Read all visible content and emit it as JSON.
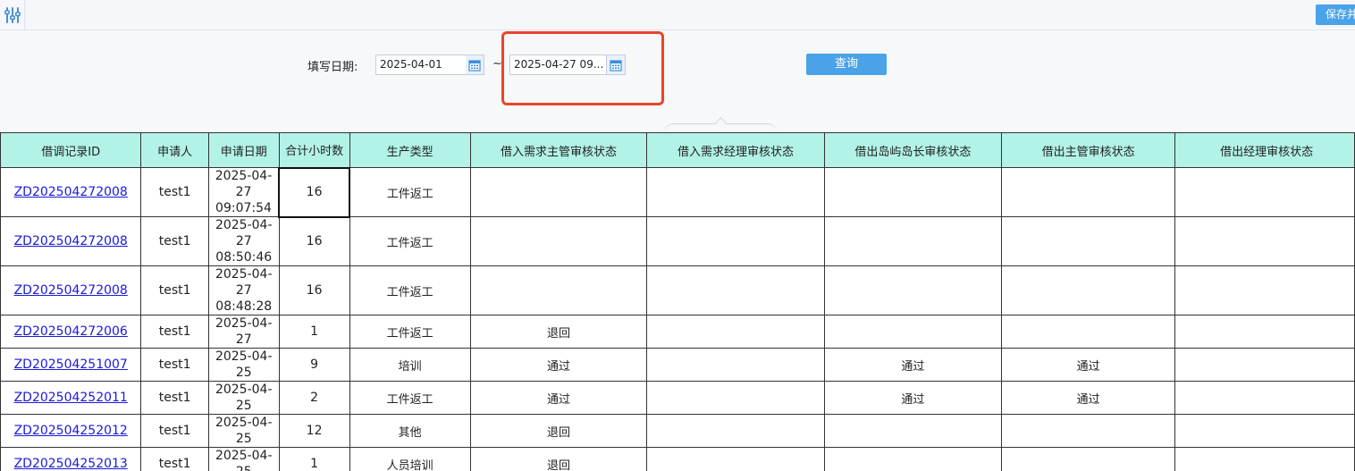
{
  "toolbar": {
    "icon": "sliders-icon",
    "save_label": "保存并"
  },
  "filter": {
    "label": "填写日期:",
    "start_date": "2025-04-01",
    "separator": "~",
    "end_date": "2025-04-27 09...",
    "query_label": "查询",
    "calendar_icon": "calendar-icon",
    "highlight_color": "#e7462b"
  },
  "table": {
    "columns": [
      "借调记录ID",
      "申请人",
      "申请日期",
      "合计小时数",
      "生产类型",
      "借入需求主管审核状态",
      "借入需求经理审核状态",
      "借出岛屿岛长审核状态",
      "借出主管审核状态",
      "借出经理审核状态"
    ],
    "rows": [
      {
        "id": "ZD202504272008",
        "user": "test1",
        "date_line1": "2025-04-27",
        "date_line2": "09:07:54",
        "hours": "16",
        "type": "工件返工",
        "s1": "",
        "s2": "",
        "s3": "",
        "s4": "",
        "s5": ""
      },
      {
        "id": "ZD202504272008",
        "user": "test1",
        "date_line1": "2025-04-27",
        "date_line2": "08:50:46",
        "hours": "16",
        "type": "工件返工",
        "s1": "",
        "s2": "",
        "s3": "",
        "s4": "",
        "s5": ""
      },
      {
        "id": "ZD202504272008",
        "user": "test1",
        "date_line1": "2025-04-27",
        "date_line2": "08:48:28",
        "hours": "16",
        "type": "工件返工",
        "s1": "",
        "s2": "",
        "s3": "",
        "s4": "",
        "s5": ""
      },
      {
        "id": "ZD202504272006",
        "user": "test1",
        "date_line1": "2025-04-27",
        "date_line2": "",
        "hours": "1",
        "type": "工件返工",
        "s1": "退回",
        "s2": "",
        "s3": "",
        "s4": "",
        "s5": ""
      },
      {
        "id": "ZD202504251007",
        "user": "test1",
        "date_line1": "2025-04-25",
        "date_line2": "",
        "hours": "9",
        "type": "培训",
        "s1": "通过",
        "s2": "",
        "s3": "通过",
        "s4": "通过",
        "s5": ""
      },
      {
        "id": "ZD202504252011",
        "user": "test1",
        "date_line1": "2025-04-25",
        "date_line2": "",
        "hours": "2",
        "type": "工件返工",
        "s1": "通过",
        "s2": "",
        "s3": "通过",
        "s4": "通过",
        "s5": ""
      },
      {
        "id": "ZD202504252012",
        "user": "test1",
        "date_line1": "2025-04-25",
        "date_line2": "",
        "hours": "12",
        "type": "其他",
        "s1": "退回",
        "s2": "",
        "s3": "",
        "s4": "",
        "s5": ""
      },
      {
        "id": "ZD202504252013",
        "user": "test1",
        "date_line1": "2025-04-25",
        "date_line2": "",
        "hours": "1",
        "type": "人员培训",
        "s1": "退回",
        "s2": "",
        "s3": "",
        "s4": "",
        "s5": ""
      }
    ]
  },
  "colors": {
    "header_bg": "#b2f2e7",
    "accent": "#4aa3e8",
    "link": "#1a1adb"
  }
}
